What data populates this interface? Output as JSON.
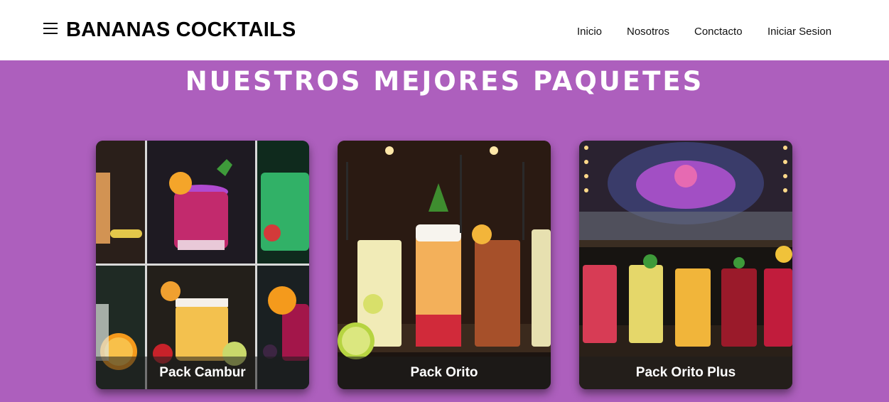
{
  "header": {
    "brand": "BANANAS COCKTAILS",
    "menu_icon": "hamburger-menu-icon",
    "nav": [
      "Inicio",
      "Nosotros",
      "Conctacto",
      "Iniciar Sesion"
    ]
  },
  "main": {
    "title": "NUESTROS MEJORES PAQUETES",
    "packs": [
      {
        "name": "Pack Cambur"
      },
      {
        "name": "Pack Orito"
      },
      {
        "name": "Pack Orito Plus"
      }
    ]
  },
  "colors": {
    "background": "#ad5fbd",
    "header": "#ffffff",
    "title": "#ffffff"
  }
}
